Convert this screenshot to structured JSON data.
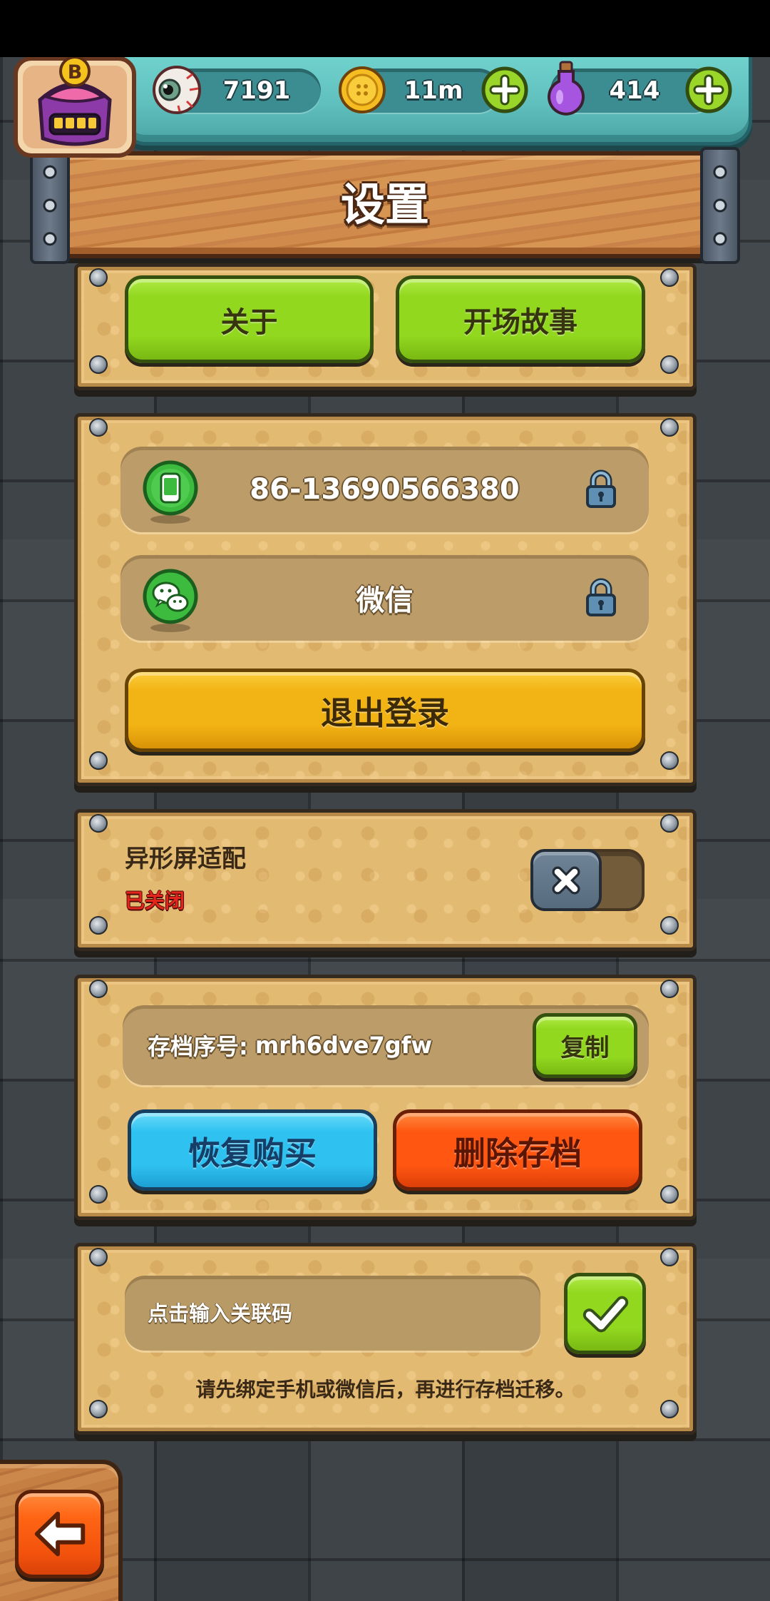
{
  "theme": {
    "green_button": "#92d81f",
    "yellow_button": "#f2b314",
    "blue_button": "#2fc2f0",
    "red_button": "#ff5712",
    "status_off": "#e4251b",
    "panel": "#e3ba72",
    "currency_bar": "#5fbfbd"
  },
  "currency_bar": {
    "avatar": {
      "icon": "monster-avatar-icon",
      "badge": "B"
    },
    "eyeballs": {
      "icon": "eyeball-icon",
      "value": "7191"
    },
    "coins": {
      "icon": "coin-icon",
      "value": "11m",
      "add_icon": "plus-icon"
    },
    "potions": {
      "icon": "potion-icon",
      "value": "414",
      "add_icon": "plus-icon"
    }
  },
  "page": {
    "title": "设置"
  },
  "info_panel": {
    "about_label": "关于",
    "story_label": "开场故事"
  },
  "account_panel": {
    "phone": {
      "icon": "phone-icon",
      "number": "86-13690566380",
      "lock_icon": "lock-icon"
    },
    "wechat": {
      "icon": "wechat-icon",
      "label": "微信",
      "lock_icon": "lock-icon"
    },
    "logout_label": "退出登录"
  },
  "display_panel": {
    "notch_adapt_label": "异形屏适配",
    "status": "已关闭",
    "toggle_on": false,
    "toggle_icon": "close-icon"
  },
  "save_panel": {
    "save_id_label": "存档序号:",
    "save_id": "mrh6dve7gfw",
    "copy_label": "复制",
    "restore_label": "恢复购买",
    "delete_label": "删除存档"
  },
  "link_panel": {
    "input_placeholder": "点击输入关联码",
    "confirm_icon": "checkmark-icon",
    "hint": "请先绑定手机或微信后，再进行存档迁移。"
  },
  "back_button": {
    "icon": "left-arrow-icon"
  }
}
